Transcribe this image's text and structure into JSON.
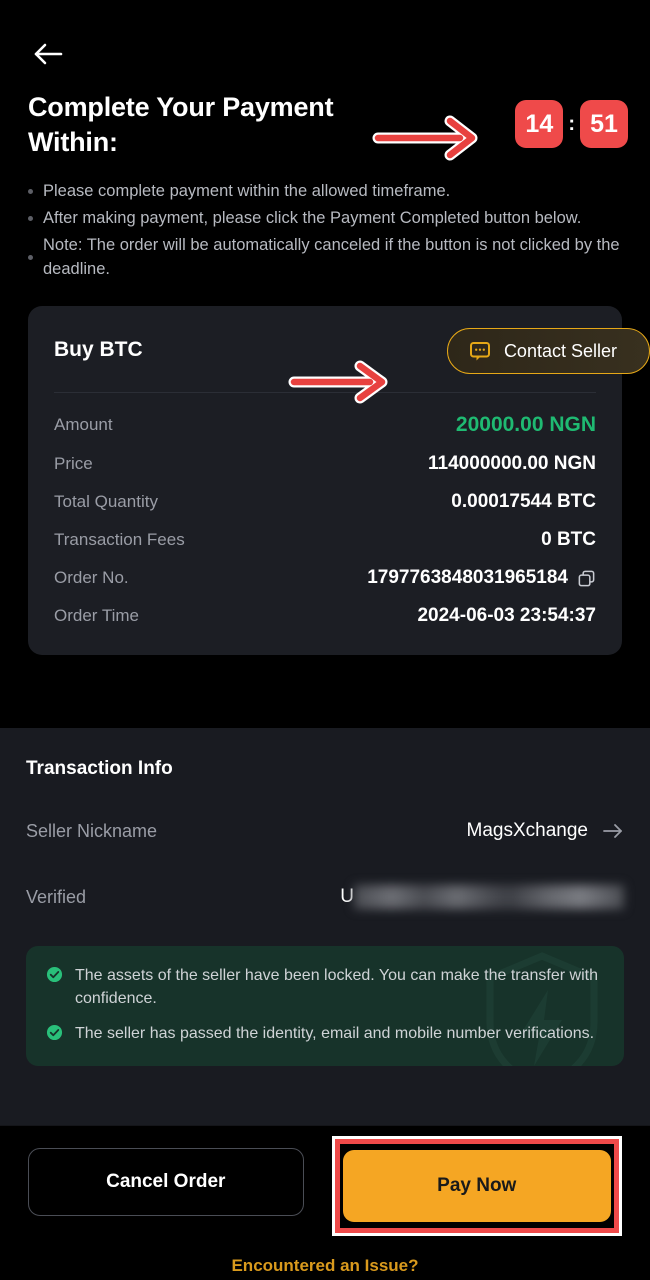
{
  "header": {
    "back_icon": "arrow-left-icon",
    "title": "Complete Your Payment Within:",
    "timer": {
      "minutes": "14",
      "separator": ":",
      "seconds": "51",
      "badge_color": "#ef4a4a"
    }
  },
  "instructions": [
    "Please complete payment within the allowed timeframe.",
    "After making payment, please click the Payment Completed button below.",
    "Note: The order will be automatically canceled if the button is not clicked by the deadline."
  ],
  "order_card": {
    "title": "Buy BTC",
    "contact_seller": {
      "label": "Contact Seller",
      "icon": "chat-bubble-icon",
      "accent_color": "#e6a817"
    },
    "rows": [
      {
        "label": "Amount",
        "value": "20000.00 NGN",
        "highlight": true,
        "color": "#1fba72"
      },
      {
        "label": "Price",
        "value": "114000000.00 NGN"
      },
      {
        "label": "Total Quantity",
        "value": "0.00017544 BTC"
      },
      {
        "label": "Transaction Fees",
        "value": "0 BTC"
      },
      {
        "label": "Order No.",
        "value": "1797763848031965184",
        "icon": "copy-icon"
      },
      {
        "label": "Order Time",
        "value": "2024-06-03 23:54:37"
      }
    ]
  },
  "transaction_info": {
    "title": "Transaction Info",
    "seller_nickname_label": "Seller Nickname",
    "seller_nickname_value": "MagsXchange",
    "seller_chevron_icon": "arrow-right-icon",
    "verified_label": "Verified",
    "verified_value_prefix": "U",
    "verified_value_redacted": true
  },
  "assurance": {
    "items": [
      "The assets of the seller have been locked. You can make the transfer with confidence.",
      "The seller has passed the identity, email and mobile number verifications."
    ],
    "check_icon": "check-circle-icon",
    "watermark_icon": "shield-icon",
    "accent_color": "#29c07a",
    "background_color": "#17332a"
  },
  "bottom_bar": {
    "cancel_label": "Cancel Order",
    "pay_label": "Pay Now",
    "pay_color": "#f5a623",
    "issue_label": "Encountered an Issue?",
    "issue_color": "#d99a1d"
  },
  "annotations": {
    "arrow_color": "#e8413f",
    "arrow_outline": "#ffffff",
    "highlight_box_color": "#ef4a4a",
    "arrows": [
      {
        "name": "arrow-to-timer",
        "target": "timer"
      },
      {
        "name": "arrow-to-contact-seller",
        "target": "contact-seller-button"
      }
    ],
    "boxes": [
      {
        "name": "highlight-pay-now",
        "target": "pay-now-button"
      }
    ]
  }
}
